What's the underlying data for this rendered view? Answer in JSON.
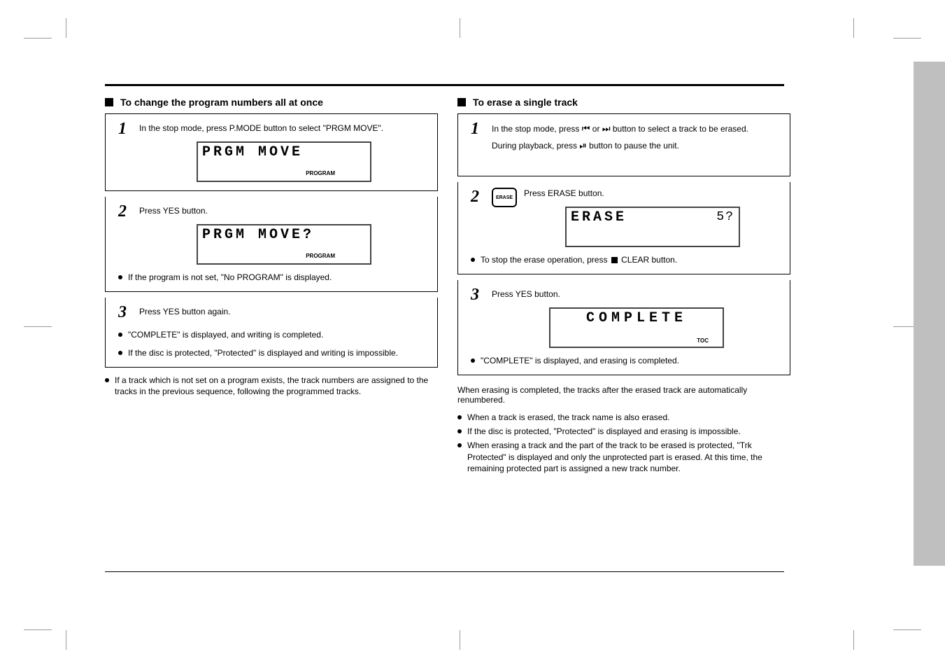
{
  "page_number": "",
  "left": {
    "heading": "To change the program numbers all at once",
    "steps": [
      {
        "num": "1",
        "instr": "In the stop mode, press P.MODE button to select \"PRGM MOVE\".",
        "lcd": {
          "line1": "PRGM MOVE",
          "sub": "PROGRAM"
        }
      },
      {
        "num": "2",
        "instr": "Press YES button.",
        "lcd": {
          "line1": "PRGM MOVE?",
          "sub": "PROGRAM"
        },
        "bullets": [
          "If the program is not set, \"No PROGRAM\" is displayed."
        ]
      },
      {
        "num": "3",
        "instr": "Press YES button again.",
        "sublines": [
          "\"COMPLETE\" is displayed, and writing is completed.",
          "If the disc is protected, \"Protected\" is displayed and writing is impossible."
        ]
      }
    ],
    "below_bullets": [
      "If a track which is not set on a program exists, the track numbers are assigned to the tracks in the previous sequence, following the programmed tracks."
    ]
  },
  "right": {
    "heading": "To erase a single track",
    "steps": [
      {
        "num": "1",
        "instr_prefix": "In the stop mode, press ",
        "icon_text1": "⏮ or ⏭",
        "instr_mid": " button to select a track to be erased.",
        "sub": "During playback, press ⏯ button to pause the unit.",
        "show_icons": true
      },
      {
        "num": "2",
        "erase_btn_label": "ERASE",
        "instr": "Press ERASE button.",
        "lcd": {
          "line1": "ERASE",
          "topright": "5?"
        },
        "bullets": [
          "To stop the erase operation, press ■ CLEAR button."
        ]
      },
      {
        "num": "3",
        "instr": "Press YES button.",
        "lcd": {
          "line1": "COMPLETE",
          "sub_toc": "TOC"
        },
        "bullets": [
          "\"COMPLETE\" is displayed, and erasing is completed."
        ]
      }
    ],
    "after_steps": [
      "When erasing is completed, the tracks after the erased track are automatically renumbered."
    ],
    "below_bullets": [
      "When a track is erased, the track name is also erased.",
      "If the disc is protected, \"Protected\" is displayed and erasing is impossible.",
      "When erasing a track and the part of the track to be erased is protected, \"Trk Protected\" is displayed and only the unprotected part is erased. At this time, the remaining protected part is assigned a new track number."
    ]
  },
  "icons": {
    "prev": "⏮",
    "next": "⏭",
    "playpause": "⏯",
    "stop": "■"
  }
}
